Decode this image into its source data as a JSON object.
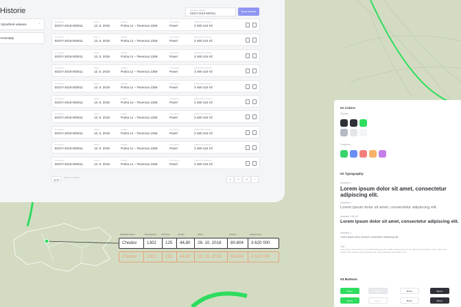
{
  "history_panel": {
    "title": "Historie",
    "search": {
      "placeholder": "Vyhledat valuaci",
      "value": "EDGY-2019-000011"
    },
    "new_button_label": "Nová valuace",
    "sidebar": [
      {
        "label": "Vytvořené valuace",
        "active": true
      },
      {
        "label": "Koncepty",
        "active": false
      }
    ],
    "columns": [
      "ID valuace",
      "Datum",
      "Lokalita",
      "Typ budovy",
      "Odhad tržní hodnoty"
    ],
    "rows": [
      {
        "id": "EDGY-2019-000011",
        "date": "13. 5. 2019",
        "address": "Praha 11 – Teverova 1356",
        "type": "Panel",
        "price": "3 480 424 Kč"
      },
      {
        "id": "EDGY-2019-000011",
        "date": "13. 5. 2019",
        "address": "Praha 11 – Teverova 1356",
        "type": "Panel",
        "price": "3 480 424 Kč"
      },
      {
        "id": "EDGY-2019-000011",
        "date": "13. 5. 2019",
        "address": "Praha 11 – Teverova 1356",
        "type": "Panel",
        "price": "3 480 424 Kč"
      },
      {
        "id": "EDGY-2019-000011",
        "date": "13. 5. 2019",
        "address": "Praha 11 – Teverova 1356",
        "type": "Panel",
        "price": "3 480 424 Kč"
      },
      {
        "id": "EDGY-2019-000011",
        "date": "13. 5. 2019",
        "address": "Praha 11 – Teverova 1356",
        "type": "Panel",
        "price": "3 480 424 Kč"
      },
      {
        "id": "EDGY-2019-000011",
        "date": "13. 5. 2019",
        "address": "Praha 11 – Teverova 1356",
        "type": "Panel",
        "price": "3 480 424 Kč"
      },
      {
        "id": "EDGY-2019-000011",
        "date": "13. 5. 2019",
        "address": "Praha 11 – Teverova 1356",
        "type": "Panel",
        "price": "3 480 424 Kč"
      },
      {
        "id": "EDGY-2019-000011",
        "date": "13. 5. 2019",
        "address": "Praha 11 – Teverova 1356",
        "type": "Panel",
        "price": "3 480 424 Kč"
      },
      {
        "id": "EDGY-2019-000011",
        "date": "13. 5. 2019",
        "address": "Praha 11 – Teverova 1356",
        "type": "Panel",
        "price": "3 480 424 Kč"
      },
      {
        "id": "EDGY-2019-000011",
        "date": "13. 5. 2019",
        "address": "Praha 11 – Teverova 1356",
        "type": "Panel",
        "price": "3 480 424 Kč"
      }
    ],
    "per_page": "10",
    "per_page_label": "Valuací na stránku",
    "pages": [
      "1",
      "2",
      "3",
      "›"
    ]
  },
  "detail_table": {
    "headers": [
      "Katastrální území",
      "Číslo popisné",
      "Číslo bytu",
      "Výměra",
      "Datum",
      "Cena/m²",
      "Celková cena"
    ],
    "row": [
      "Chodov",
      "1302",
      "125",
      "44,80",
      "26. 10. 2018",
      "80.804",
      "3 620 000"
    ]
  },
  "styleguide": {
    "colors_title": "01 Colors",
    "primary_label": "Primary",
    "gradients_label": "Gradients",
    "typography_title": "02 Typography",
    "headline1_label": "Headline 1",
    "headline1_text": "Lorem ipsum dolor sit amet, consectetur adipiscing elit.",
    "headline2_label": "Headline 2",
    "headline2_text": "Lorem ipsum dolor sit amet, consectetur adipiscing elit.",
    "headline3_label": "Headline 3 BOLD",
    "headline3_text": "Lorem ipsum dolor sit amet, consectetur adipiscing elit.",
    "headline4_label": "Headline 4",
    "headline4_text": "Lorem ipsum dolor sit amet, consectetur adipiscing elit.",
    "text_label": "Text",
    "text_body": "Lorem ipsum dolor sit amet, consectetur adipiscing elit. Nullam malesuada nunc sem blandit nisl vestibulum vitae mattis. Duis feugiat, dolor pulvinar viverra tristique nibh, vitae vestibulum turpis nibh ut nisi.",
    "buttons_title": "03 Buttons",
    "button_label": "Button"
  },
  "colors": {
    "accent_green": "#2edc5e",
    "dark": "#2e3138",
    "primary_swatches": [
      "#2e3138",
      "#2e3138",
      "#2edc5e",
      "#b5bac4",
      "#e4e6ea",
      "#f3f4f6"
    ],
    "gradient_swatches": [
      "#38d36a",
      "#6b8ef7",
      "#f37f7d",
      "#f7b36a",
      "#c57de9"
    ]
  }
}
